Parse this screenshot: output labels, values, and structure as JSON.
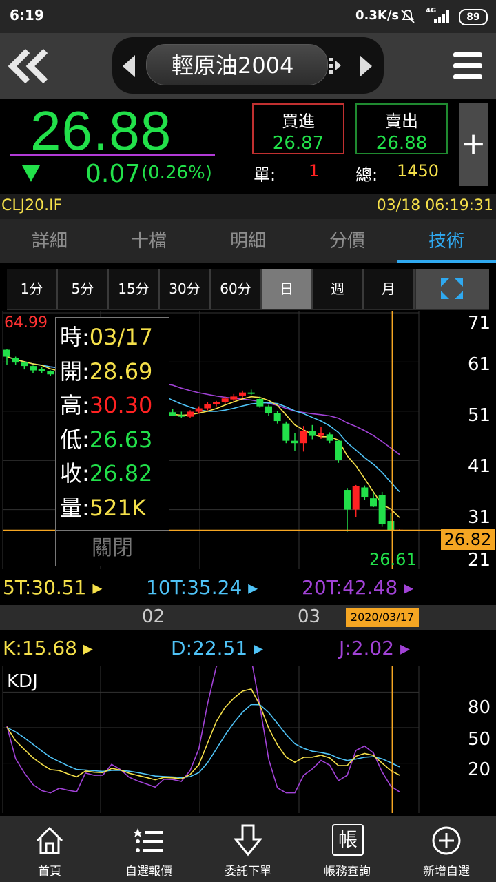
{
  "status_bar": {
    "time": "6:19",
    "network_speed": "0.3K/s",
    "signal": "4G",
    "battery": "89"
  },
  "header": {
    "title": "輕原油2004",
    "back_icon": "double-chevron-left-icon",
    "menu_icon": "hamburger-icon"
  },
  "quote": {
    "price": "26.88",
    "direction_icon": "down-triangle-icon",
    "change": "0.07",
    "change_pct": "(0.26%)",
    "bid_label": "買進",
    "bid": "26.87",
    "ask_label": "賣出",
    "ask": "26.88",
    "unit_label": "單:",
    "unit_value": "1",
    "total_label": "總:",
    "total_value": "1450",
    "add_label": "+"
  },
  "code_row": {
    "symbol": "CLJ20.IF",
    "datetime": "03/18 06:19:31"
  },
  "tabs": [
    {
      "label": "詳細"
    },
    {
      "label": "十檔"
    },
    {
      "label": "明細"
    },
    {
      "label": "分價"
    },
    {
      "label": "技術"
    }
  ],
  "active_tab": "技術",
  "periods": [
    {
      "label": "1分"
    },
    {
      "label": "5分"
    },
    {
      "label": "15分"
    },
    {
      "label": "30分"
    },
    {
      "label": "60分"
    },
    {
      "label": "日"
    },
    {
      "label": "週"
    },
    {
      "label": "月"
    }
  ],
  "selected_period": "日",
  "colors": {
    "up": "#ff2222",
    "down": "#22e04a",
    "ma5": "#f5e04a",
    "ma10": "#4fc3f7",
    "ma20": "#a142d6",
    "accent": "#2fa9f0",
    "highlight": "#f5a623"
  },
  "chart_data": [
    {
      "type": "candlestick",
      "y_ticks": [
        "71",
        "61",
        "51",
        "41",
        "31",
        "21"
      ],
      "ylim": [
        21,
        71
      ],
      "max_label": "64.99",
      "min_label": "26.61",
      "current_label": "26.82",
      "x_ticks": [
        "02",
        "03"
      ],
      "selected_date": "2020/03/17",
      "candles": [
        [
          63.5,
          63.6,
          60.5,
          62.1
        ],
        [
          61.8,
          62.1,
          60.4,
          60.9
        ],
        [
          60.9,
          61.0,
          59.5,
          60.2
        ],
        [
          60.2,
          60.3,
          58.8,
          59.3
        ],
        [
          59.6,
          60.0,
          58.8,
          59.2
        ],
        [
          59.2,
          59.3,
          58.2,
          58.5
        ],
        [
          58.4,
          59.0,
          57.9,
          58.6
        ],
        [
          58.6,
          58.9,
          58.0,
          58.2
        ],
        [
          58.4,
          58.7,
          57.8,
          58.0
        ],
        [
          58.0,
          58.8,
          57.4,
          58.5
        ],
        [
          58.3,
          58.7,
          57.1,
          57.5
        ],
        [
          57.7,
          58.0,
          56.8,
          57.2
        ],
        [
          57.0,
          57.5,
          56.5,
          57.3
        ],
        [
          57.2,
          57.4,
          55.0,
          55.5
        ],
        [
          55.0,
          55.4,
          52.5,
          52.9
        ],
        [
          53.0,
          53.6,
          50.5,
          51.0
        ],
        [
          51.0,
          51.4,
          49.9,
          50.3
        ],
        [
          50.3,
          50.8,
          49.8,
          50.0
        ],
        [
          50.0,
          51.0,
          49.5,
          50.6
        ],
        [
          50.8,
          51.5,
          50.0,
          50.1
        ],
        [
          50.2,
          50.9,
          49.6,
          49.9
        ],
        [
          49.9,
          51.2,
          49.6,
          50.9
        ],
        [
          50.9,
          52.0,
          50.5,
          51.6
        ],
        [
          51.6,
          52.8,
          51.2,
          52.5
        ],
        [
          52.4,
          53.1,
          52.0,
          52.8
        ],
        [
          52.8,
          54.0,
          52.4,
          53.6
        ],
        [
          53.4,
          54.5,
          53.0,
          54.0
        ],
        [
          54.2,
          55.2,
          53.8,
          54.8
        ],
        [
          54.8,
          55.4,
          54.3,
          54.6
        ],
        [
          53.5,
          54.0,
          51.7,
          52.0
        ],
        [
          52.0,
          52.3,
          50.0,
          50.6
        ],
        [
          50.6,
          51.0,
          48.5,
          49.0
        ],
        [
          48.5,
          48.9,
          44.5,
          45.0
        ],
        [
          45.0,
          46.5,
          43.0,
          44.5
        ],
        [
          44.5,
          48.0,
          42.8,
          47.0
        ],
        [
          47.0,
          48.2,
          45.3,
          46.0
        ],
        [
          46.0,
          47.8,
          45.4,
          46.6
        ],
        [
          46.3,
          46.7,
          44.5,
          45.0
        ],
        [
          45.0,
          45.2,
          40.5,
          41.1
        ],
        [
          35.0,
          35.4,
          26.5,
          31.0
        ],
        [
          31.0,
          36.0,
          29.5,
          35.8
        ],
        [
          35.5,
          35.9,
          33.0,
          33.6
        ],
        [
          33.3,
          34.5,
          31.5,
          31.6
        ],
        [
          34.0,
          34.6,
          27.5,
          28.0
        ],
        [
          28.7,
          30.3,
          26.6,
          26.8
        ],
        [
          26.9,
          27.0,
          26.6,
          26.9
        ]
      ],
      "series": [
        {
          "name": "5T",
          "value": "30.51"
        },
        {
          "name": "10T",
          "value": "35.24"
        },
        {
          "name": "20T",
          "value": "42.48"
        }
      ]
    },
    {
      "type": "line",
      "title": "KDJ",
      "y_ticks": [
        "80",
        "50",
        "20"
      ],
      "ylim": [
        0,
        100
      ],
      "series": [
        {
          "name": "K",
          "value": "15.68"
        },
        {
          "name": "D",
          "value": "22.51"
        },
        {
          "name": "J",
          "value": "2.02"
        }
      ]
    }
  ],
  "tooltip": {
    "rows": [
      {
        "label": "時:",
        "value": "03/17"
      },
      {
        "label": "開:",
        "value": "28.69"
      },
      {
        "label": "高:",
        "value": "30.30"
      },
      {
        "label": "低:",
        "value": "26.63"
      },
      {
        "label": "收:",
        "value": "26.82"
      },
      {
        "label": "量:",
        "value": "521K"
      }
    ],
    "close_label": "關閉"
  },
  "bottom_nav": [
    {
      "label": "首頁",
      "icon": "home-icon"
    },
    {
      "label": "自選報價",
      "icon": "list-icon"
    },
    {
      "label": "委託下單",
      "icon": "down-arrow-icon"
    },
    {
      "label": "帳務查詢",
      "icon": "ledger-icon",
      "glyph": "帳"
    },
    {
      "label": "新增自選",
      "icon": "plus-circle-icon"
    }
  ]
}
